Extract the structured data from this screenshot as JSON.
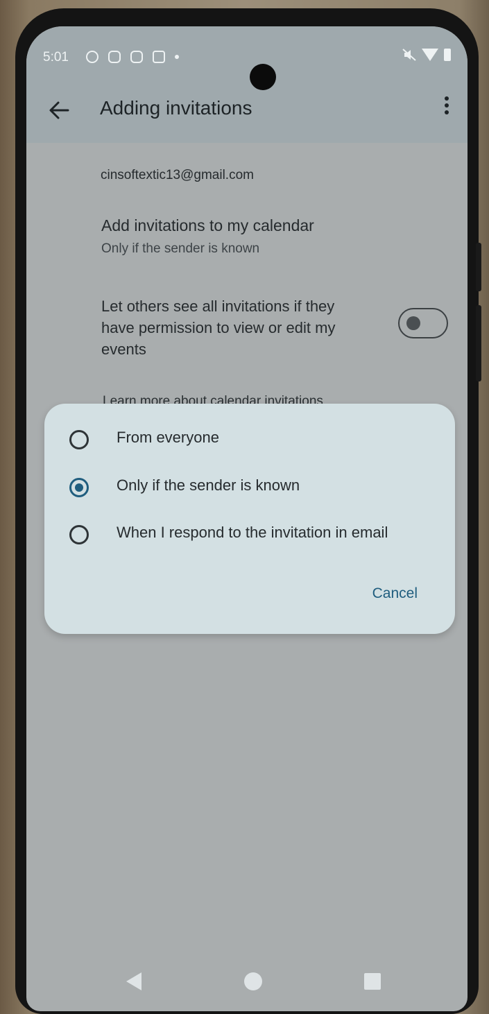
{
  "status_bar": {
    "time": "5:01",
    "notification_icons": [
      "app-notification-icon",
      "sim-icon",
      "bag-icon",
      "message-icon"
    ],
    "system_icons": [
      "mute-icon",
      "wifi-icon",
      "battery-icon"
    ]
  },
  "app_bar": {
    "title": "Adding invitations",
    "back_icon": "arrow-left-icon",
    "menu_icon": "more-vert-icon"
  },
  "settings": {
    "account": "cinsoftextic13@gmail.com",
    "add_invitations_title": "Add invitations to my calendar",
    "add_invitations_value": "Only if the sender is known",
    "share_invitations_label": "Let others see all invitations if they have permission to view or edit my events",
    "share_invitations_enabled": false,
    "learn_more": "Learn more about calendar invitations"
  },
  "dialog": {
    "options": [
      {
        "label": "From everyone",
        "selected": false
      },
      {
        "label": "Only if the sender is known",
        "selected": true
      },
      {
        "label": "When I respond to the invitation in email",
        "selected": false
      }
    ],
    "cancel_label": "Cancel"
  },
  "colors": {
    "accent": "#1f5d7e",
    "dialog_bg": "#d3e0e3",
    "scrim_bg": "#a9adae"
  }
}
